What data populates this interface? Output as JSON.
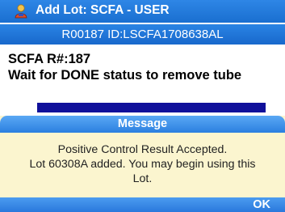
{
  "window": {
    "title": "Add Lot: SCFA - USER",
    "icon": "user-icon",
    "colors": {
      "title_bar": "#1e74dc",
      "dialog_bg": "#fbf5cf",
      "progress": "#10109a"
    }
  },
  "id_bar": {
    "text": "R00187 ID:LSCFA1708638AL"
  },
  "content": {
    "line1": "SCFA R#:187",
    "line2": "Wait for DONE status to remove tube",
    "progress": 1.0
  },
  "dialog": {
    "header": "Message",
    "line1": "Positive Control Result Accepted.",
    "line2": "Lot 60308A added.  You may begin using this",
    "line3": "Lot.",
    "ok_label": "OK"
  }
}
